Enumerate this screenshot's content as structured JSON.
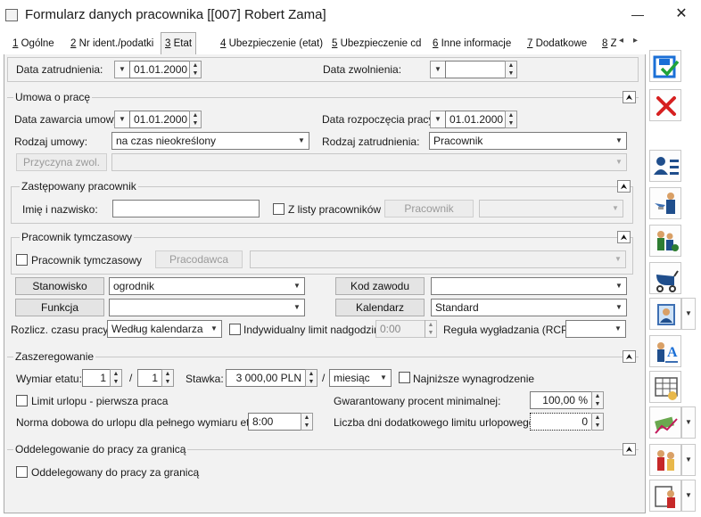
{
  "window": {
    "title": "Formularz danych pracownika [[007] Robert Zama]",
    "minimize": "—",
    "close": "✕"
  },
  "tabs": [
    {
      "num": "1",
      "label": "Ogólne"
    },
    {
      "num": "2",
      "label": "Nr ident./podatki"
    },
    {
      "num": "3",
      "label": "Etat"
    },
    {
      "num": "4",
      "label": "Ubezpieczenie (etat)"
    },
    {
      "num": "5",
      "label": "Ubezpieczenie cd"
    },
    {
      "num": "6",
      "label": "Inne informacje"
    },
    {
      "num": "7",
      "label": "Dodatkowe"
    },
    {
      "num": "8",
      "label": "Z"
    }
  ],
  "active_tab": "Etat",
  "dates": {
    "data_zatrudnienia_label": "Data zatrudnienia:",
    "data_zatrudnienia": "01.01.2000",
    "data_zwolnienia_label": "Data zwolnienia:",
    "data_zwolnienia": ""
  },
  "umowa": {
    "title": "Umowa o pracę",
    "data_zawarcia_label": "Data zawarcia umowy:",
    "data_zawarcia": "01.01.2000",
    "data_rozpoczecia_label": "Data rozpoczęcia pracy:",
    "data_rozpoczecia": "01.01.2000",
    "rodzaj_umowy_label": "Rodzaj umowy:",
    "rodzaj_umowy": "na czas nieokreślony",
    "rodzaj_zatrudnienia_label": "Rodzaj zatrudnienia:",
    "rodzaj_zatrudnienia": "Pracownik",
    "przyczyna_button": "Przyczyna zwol.",
    "przyczyna": ""
  },
  "zastepowany": {
    "title": "Zastępowany pracownik",
    "imie_label": "Imię i nazwisko:",
    "imie": "",
    "z_listy_label": "Z listy pracowników",
    "pracownik_button": "Pracownik",
    "pracownik": ""
  },
  "tymczasowy": {
    "title": "Pracownik tymczasowy",
    "checkbox_label": "Pracownik tymczasowy",
    "pracodawca_button": "Pracodawca",
    "pracodawca": ""
  },
  "stanowisko": {
    "button": "Stanowisko",
    "value": "ogrodnik",
    "kod_zawodu_button": "Kod zawodu",
    "kod_zawodu": ""
  },
  "funkcja": {
    "button": "Funkcja",
    "value": "",
    "kalendarz_button": "Kalendarz",
    "kalendarz": "Standard"
  },
  "rozlicz": {
    "label": "Rozlicz. czasu pracy:",
    "value": "Według kalendarza",
    "indywidualny_label": "Indywidualny limit nadgodzin:",
    "indywidualny": "0:00",
    "regula_label": "Reguła wygładzania (RCP):",
    "regula": ""
  },
  "zaszeregowanie": {
    "title": "Zaszeregowanie",
    "wymiar_label": "Wymiar etatu:",
    "wymiar_licznik": "1",
    "wymiar_sep": "/",
    "wymiar_mianownik": "1",
    "stawka_label": "Stawka:",
    "stawka": "3 000,00 PLN",
    "stawka_sep": "/",
    "okres": "miesiąc",
    "najnizsze_label": "Najniższe wynagrodzenie",
    "limit_urlopu_label": "Limit urlopu - pierwsza praca",
    "gwarantowany_label": "Gwarantowany procent minimalnej:",
    "gwarantowany": "100,00 %",
    "norma_label": "Norma dobowa do urlopu dla pełnego wymiaru etatu:",
    "norma": "8:00",
    "liczba_dni_label": "Liczba dni dodatkowego limitu urlopowego:",
    "liczba_dni": "0"
  },
  "oddelegowanie": {
    "title": "Oddelegowanie do pracy za granicą",
    "checkbox_label": "Oddelegowany do pracy za granicą"
  },
  "icons": {
    "collapse": "⮝",
    "dropdown": "▼",
    "spin_up": "▲",
    "spin_down": "▼",
    "scroll_left": "◂",
    "scroll_right": "▸"
  },
  "colors": {
    "save": "#1a6fd6",
    "cancel": "#d62020",
    "panel": "#f2f2f2"
  }
}
